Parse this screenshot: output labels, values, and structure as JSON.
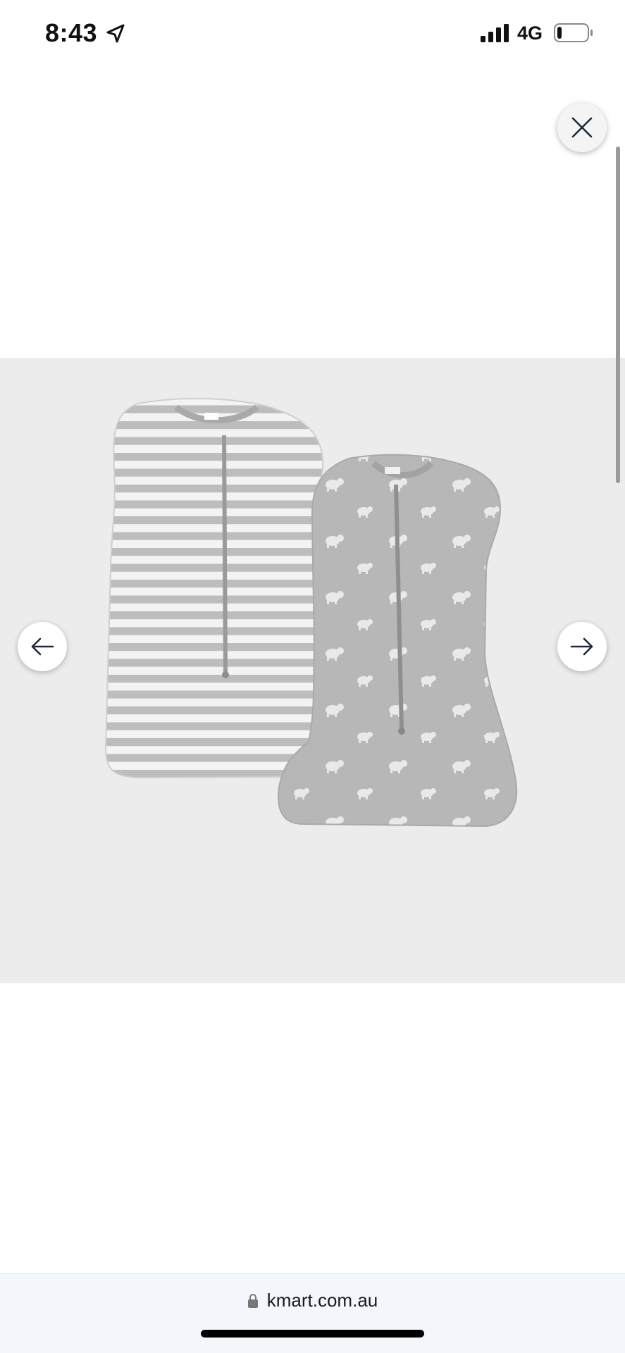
{
  "status_bar": {
    "time": "8:43",
    "network": "4G",
    "icons": [
      "location-arrow-icon",
      "signal-bars-icon",
      "battery-icon"
    ],
    "battery_level": 0.15
  },
  "gallery": {
    "image_alt": "Two grey baby swaddle sleep bags: one striped, one with elephant print",
    "icons": [
      "close-icon",
      "arrow-left-icon",
      "arrow-right-icon"
    ],
    "colors": {
      "panel_bg": "#ececec",
      "garment_grey": "#b9b9b9",
      "stripe_white": "#f2f2f2"
    }
  },
  "browser": {
    "url": "kmart.com.au",
    "icons": [
      "lock-icon"
    ]
  }
}
